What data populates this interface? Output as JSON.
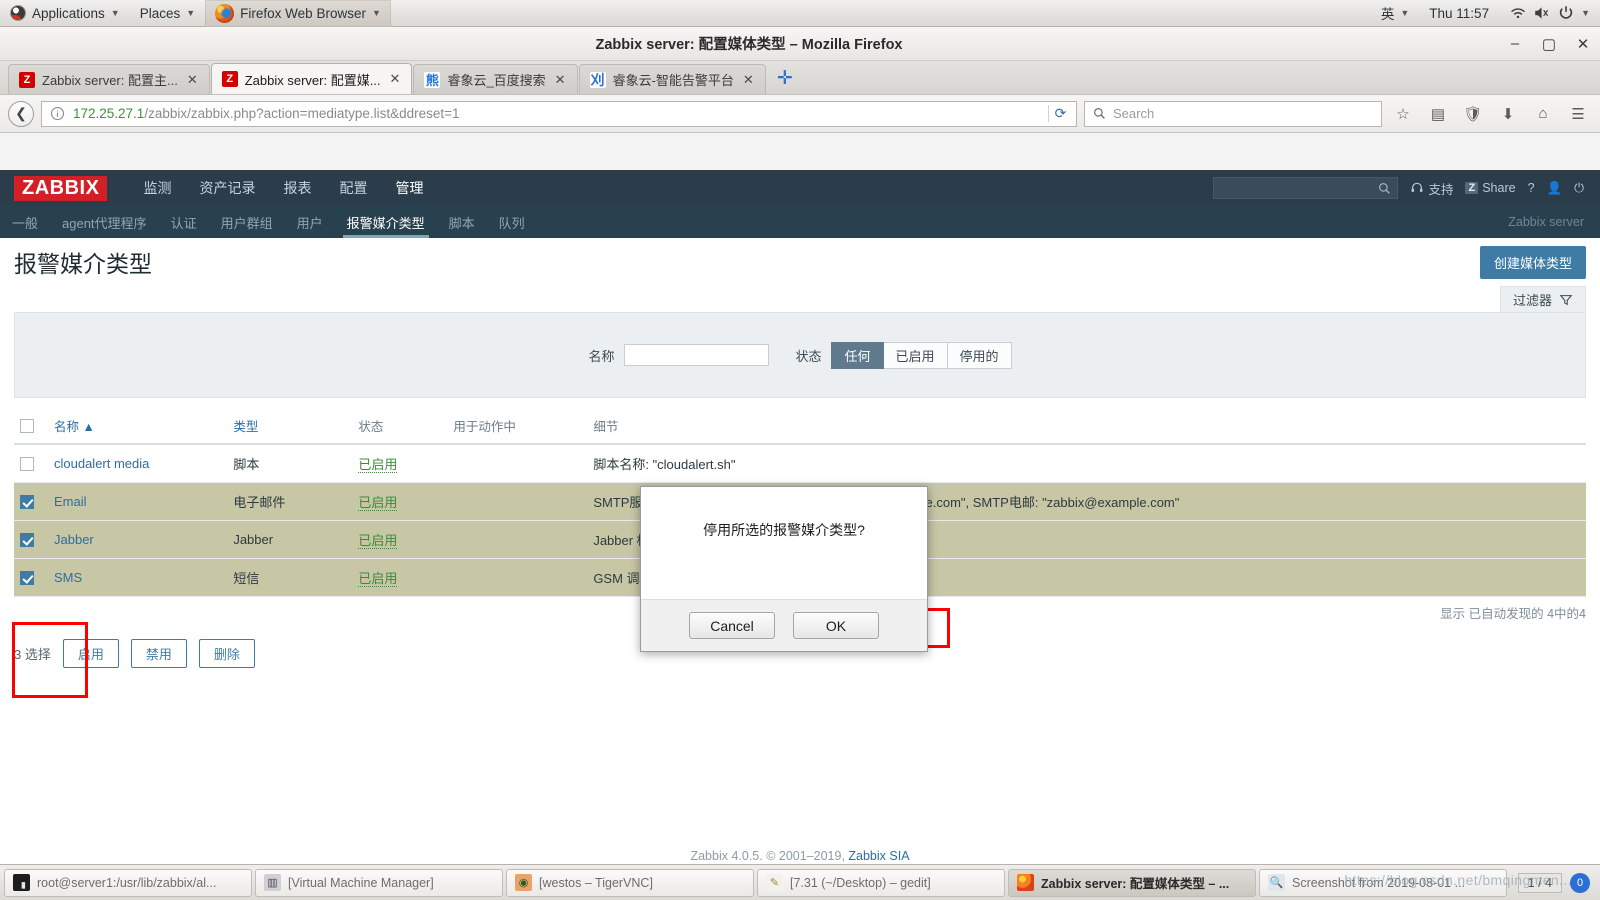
{
  "desktop": {
    "applications_label": "Applications",
    "places_label": "Places",
    "active_app_label": "Firefox Web Browser",
    "input_method": "英",
    "clock": "Thu 11:57"
  },
  "browser": {
    "window_title": "Zabbix server: 配置媒体类型 – Mozilla Firefox",
    "tabs": [
      {
        "label": "Zabbix server: 配置主...",
        "favicon": "zabbix-icon",
        "selected": false
      },
      {
        "label": "Zabbix server: 配置媒...",
        "favicon": "zabbix-icon",
        "selected": true
      },
      {
        "label": "睿象云_百度搜索",
        "favicon": "baidu-icon",
        "selected": false
      },
      {
        "label": "睿象云-智能告警平台",
        "favicon": "site-icon",
        "selected": false
      }
    ],
    "url_host": "172.25.27.1",
    "url_path": "/zabbix/zabbix.php?action=mediatype.list&ddreset=1",
    "search_placeholder": "Search"
  },
  "zabbix": {
    "logo": "ZABBIX",
    "main_nav": [
      {
        "label": "监测",
        "active": false
      },
      {
        "label": "资产记录",
        "active": false
      },
      {
        "label": "报表",
        "active": false
      },
      {
        "label": "配置",
        "active": false
      },
      {
        "label": "管理",
        "active": true
      }
    ],
    "sub_nav": [
      {
        "label": "一般",
        "active": false
      },
      {
        "label": "agent代理程序",
        "active": false
      },
      {
        "label": "认证",
        "active": false
      },
      {
        "label": "用户群组",
        "active": false
      },
      {
        "label": "用户",
        "active": false
      },
      {
        "label": "报警媒介类型",
        "active": true
      },
      {
        "label": "脚本",
        "active": false
      },
      {
        "label": "队列",
        "active": false
      }
    ],
    "support_label": "支持",
    "share_label": "Share",
    "share_badge": "Z",
    "server_label": "Zabbix server",
    "page_title": "报警媒介类型",
    "create_button": "创建媒体类型",
    "filter_tab_label": "过滤器",
    "filter": {
      "name_label": "名称",
      "name_value": "",
      "status_label": "状态",
      "status_options": [
        {
          "label": "任何",
          "selected": true
        },
        {
          "label": "已启用",
          "selected": false
        },
        {
          "label": "停用的",
          "selected": false
        }
      ]
    },
    "table": {
      "columns": [
        "名称 ▲",
        "类型",
        "状态",
        "用于动作中",
        "细节"
      ],
      "rows": [
        {
          "checked": false,
          "name": "cloudalert media",
          "type": "脚本",
          "status": "已启用",
          "used_in_actions": "",
          "details": "脚本名称: \"cloudalert.sh\""
        },
        {
          "checked": true,
          "name": "Email",
          "type": "电子邮件",
          "status": "已启用",
          "used_in_actions": "",
          "details": "SMTP服务器: \"mail.example.com\", SMTP HELO: \"example.com\", SMTP电邮: \"zabbix@example.com\""
        },
        {
          "checked": true,
          "name": "Jabber",
          "type": "Jabber",
          "status": "已启用",
          "used_in_actions": "",
          "details": "Jabber 标识符: \"jabber@example.com\""
        },
        {
          "checked": true,
          "name": "SMS",
          "type": "短信",
          "status": "已启用",
          "used_in_actions": "",
          "details": "GSM 调制解调器: \"/dev/ttyS0\""
        }
      ],
      "summary": "显示 已自动发现的 4中的4"
    },
    "selection_count": "3 选择",
    "actions": [
      {
        "label": "启用"
      },
      {
        "label": "禁用"
      },
      {
        "label": "删除"
      }
    ],
    "footer_text": "Zabbix 4.0.5. © 2001–2019, ",
    "footer_link": "Zabbix SIA"
  },
  "dialog": {
    "message": "停用所选的报警媒介类型?",
    "cancel_label": "Cancel",
    "ok_label": "OK"
  },
  "taskbar": {
    "items": [
      {
        "label": "root@server1:/usr/lib/zabbix/al...",
        "icon": "terminal-icon",
        "active": false
      },
      {
        "label": "[Virtual Machine Manager]",
        "icon": "vmm-icon",
        "active": false
      },
      {
        "label": "[westos – TigerVNC]",
        "icon": "vnc-icon",
        "active": false
      },
      {
        "label": "[7.31 (~/Desktop) – gedit]",
        "icon": "gedit-icon",
        "active": false
      },
      {
        "label": "Zabbix server: 配置媒体类型 – ...",
        "icon": "firefox-icon",
        "active": true
      },
      {
        "label": "Screenshot from 2019-08-01 ...",
        "icon": "screenshot-icon",
        "active": false
      }
    ],
    "workspace": "1 / 4",
    "workspace_badge": "0"
  },
  "watermark": "https://blog.csdn.net/bmqingmen..."
}
